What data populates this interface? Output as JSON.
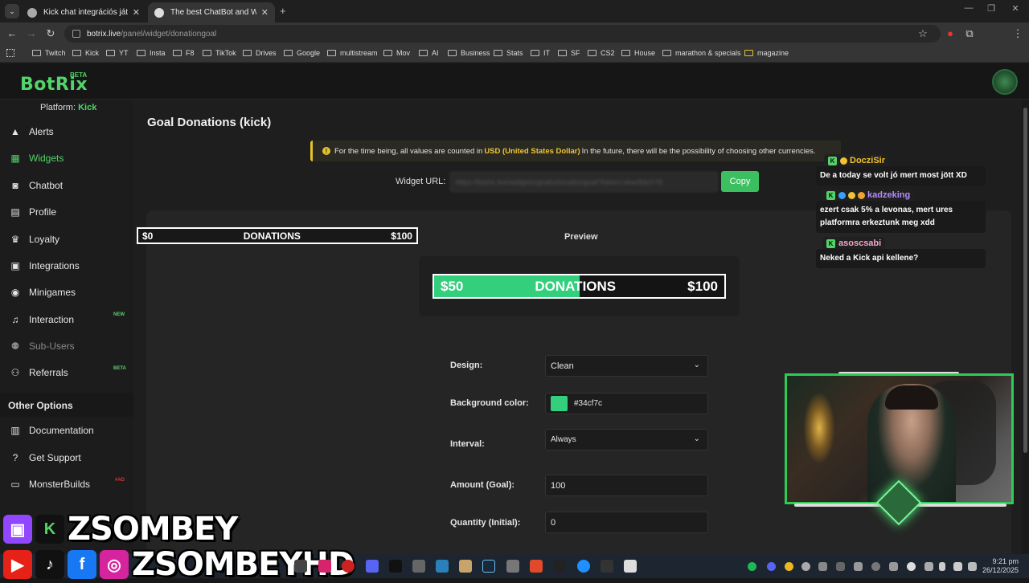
{
  "browser": {
    "tabs": [
      {
        "title": "Kick chat integrációs játékok",
        "active": false
      },
      {
        "title": "The best ChatBot and Widgets",
        "active": true
      }
    ],
    "url_host": "botrix.live",
    "url_path": "/panel/widget/donationgoal",
    "bookmarks": [
      "Twitch",
      "Kick",
      "YT",
      "Insta",
      "F8",
      "TikTok",
      "Drives",
      "Google",
      "multistream",
      "Mov",
      "AI",
      "Business",
      "Stats",
      "IT",
      "SF",
      "CS2",
      "House",
      "marathon & specials",
      "magazine"
    ]
  },
  "app": {
    "logo": "BotRix",
    "logo_badge": "BETA",
    "platform_label": "Platform:",
    "platform_value": "Kick",
    "sidebar": [
      {
        "label": "Alerts",
        "icon": "warning-icon"
      },
      {
        "label": "Widgets",
        "icon": "grid-icon",
        "active": true
      },
      {
        "label": "Chatbot",
        "icon": "robot-icon"
      },
      {
        "label": "Profile",
        "icon": "id-card-icon"
      },
      {
        "label": "Loyalty",
        "icon": "trophy-icon"
      },
      {
        "label": "Integrations",
        "icon": "plug-icon"
      },
      {
        "label": "Minigames",
        "icon": "gamepad-icon"
      },
      {
        "label": "Interaction",
        "icon": "music-icon",
        "badge": "NEW"
      },
      {
        "label": "Sub-Users",
        "icon": "users-icon",
        "dim": true
      },
      {
        "label": "Referrals",
        "icon": "people-icon",
        "badge": "BETA"
      }
    ],
    "other_options_title": "Other Options",
    "other_options": [
      {
        "label": "Documentation",
        "icon": "book-icon"
      },
      {
        "label": "Get Support",
        "icon": "help-icon"
      },
      {
        "label": "MonsterBuilds",
        "icon": "laptop-icon",
        "badge": "#AD"
      }
    ],
    "page_title": "Goal Donations (kick)",
    "notice": {
      "prefix": "For the time being, all values are counted in",
      "currency": "USD (United States Dollar)",
      "suffix": "In the future, there will be the possibility of choosing other currencies."
    },
    "widget_url_label": "Widget URL:",
    "widget_url_value": "https://botrix.live/widgets/goals/donationgoal?token=xkwr8dc0-f3",
    "copy_label": "Copy",
    "goal_small": {
      "left": "$0",
      "center": "DONATIONS",
      "right": "$100"
    },
    "preview_label": "Preview",
    "goal_preview": {
      "left": "$50",
      "center": "DONATIONS",
      "right": "$100",
      "progress": 0.5
    },
    "form": {
      "design_label": "Design:",
      "design_value": "Clean",
      "bg_color_label": "Background color:",
      "bg_color_value": "#34cf7c",
      "interval_label": "Interval:",
      "interval_value": "Always",
      "amount_label": "Amount (Goal):",
      "amount_value": "100",
      "quantity_label": "Quantity (Initial):",
      "quantity_value": "0"
    }
  },
  "chat": [
    {
      "user": "DocziSir",
      "user_color": "#f1c232",
      "message": "De a today se volt jó mert most jött XD"
    },
    {
      "user": "kadzeking",
      "user_color": "#b48cff",
      "message": "ezert csak 5% a levonas, mert ures platformra erkeztunk meg xdd"
    },
    {
      "user": "asoscsabi",
      "user_color": "#f4a6c8",
      "message": "Neked a Kick api kellene?"
    }
  ],
  "streamer": {
    "name1": "ZSOMBEY",
    "name2": "ZSOMBEYHD"
  },
  "taskbar": {
    "time": "9:21 pm",
    "date": "26/12/2025"
  },
  "colors": {
    "accent": "#53d36a",
    "goal_fill": "#34cf7c",
    "notice": "#e5c32b"
  }
}
